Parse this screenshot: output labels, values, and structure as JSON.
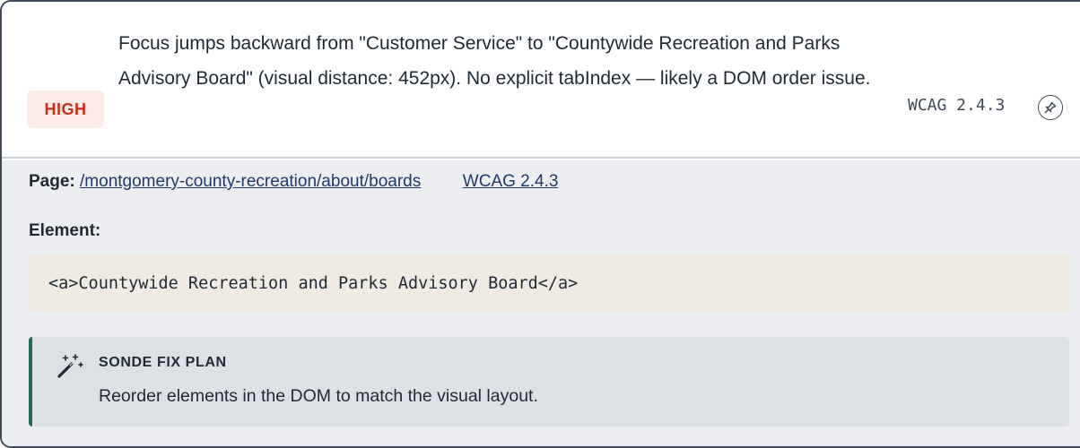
{
  "issue": {
    "severity": "HIGH",
    "message": "Focus jumps backward from \"Customer Service\" to \"Countywide Recreation and Parks Advisory Board\" (visual distance: 452px). No explicit tabIndex — likely a DOM order issue.",
    "wcag_code": "WCAG 2.4.3",
    "pin_icon": "pin-icon"
  },
  "details": {
    "page_label": "Page:",
    "page_url": "/montgomery-county-recreation/about/boards",
    "wcag_link": "WCAG 2.4.3",
    "element_label": "Element:",
    "element_code": "<a>Countywide Recreation and Parks Advisory Board</a>"
  },
  "fix_plan": {
    "icon": "magic-wand-icon",
    "title": "SONDE FIX PLAN",
    "text": "Reorder elements in the DOM to match the visual layout."
  },
  "colors": {
    "severity_high": "#c6311a",
    "accent": "#1e6b5c",
    "link": "#1f3a68"
  }
}
